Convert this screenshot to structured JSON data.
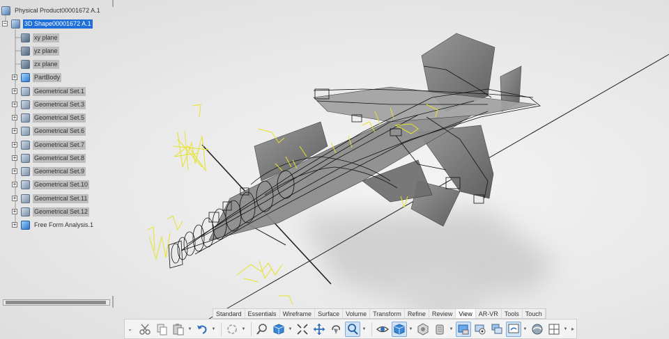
{
  "tree": {
    "root": {
      "label": "Physical Product00001672 A.1",
      "icon": "product-icon"
    },
    "shape": {
      "label": "3D Shape00001672 A.1",
      "icon": "3d-shape-icon"
    },
    "planes": [
      {
        "label": "xy plane",
        "icon": "plane-icon"
      },
      {
        "label": "yz plane",
        "icon": "plane-icon"
      },
      {
        "label": "zx plane",
        "icon": "plane-icon"
      }
    ],
    "nodes": [
      {
        "label": "PartBody",
        "icon": "part-body-icon"
      },
      {
        "label": "Geometrical Set.1",
        "icon": "geometrical-set-icon"
      },
      {
        "label": "Geometrical Set.3",
        "icon": "geometrical-set-icon"
      },
      {
        "label": "Geometrical Set.5",
        "icon": "geometrical-set-icon"
      },
      {
        "label": "Geometrical Set.6",
        "icon": "geometrical-set-icon"
      },
      {
        "label": "Geometrical Set.7",
        "icon": "geometrical-set-icon"
      },
      {
        "label": "Geometrical Set.8",
        "icon": "geometrical-set-icon"
      },
      {
        "label": "Geometrical Set.9",
        "icon": "geometrical-set-icon"
      },
      {
        "label": "Geometrical Set.10",
        "icon": "geometrical-set-icon"
      },
      {
        "label": "Geometrical Set.11",
        "icon": "geometrical-set-icon"
      },
      {
        "label": "Geometrical Set.12",
        "icon": "geometrical-set-icon"
      },
      {
        "label": "Free Form Analysis.1",
        "icon": "free-form-analysis-icon"
      }
    ],
    "expander_symbol": "+",
    "collapse_symbol": "−"
  },
  "actionbar": {
    "tabs": [
      "Standard",
      "Essentials",
      "Wireframe",
      "Surface",
      "Volume",
      "Transform",
      "Refine",
      "Review",
      "View",
      "AR-VR",
      "Tools",
      "Touch"
    ],
    "active_tab": "View",
    "tools": [
      "cut-icon",
      "copy-icon",
      "paste-icon",
      "undo-icon",
      "update-icon",
      "fit-all-icon",
      "view-cube-icon",
      "zoom-area-icon",
      "pan-icon",
      "rotate-icon",
      "zoom-icon",
      "look-at-icon",
      "shading-icon",
      "render-style-icon",
      "hide-show-icon",
      "swap-visible-icon",
      "capture-icon",
      "multi-view-icon",
      "sync-icon",
      "reframe-icon",
      "layout-icon"
    ]
  },
  "colors": {
    "selection": "#1e6fd9",
    "label_bg": "#bdbdbd",
    "wire": "#111111",
    "curve": "#e6e22a",
    "surface": "#7a7a7a"
  }
}
